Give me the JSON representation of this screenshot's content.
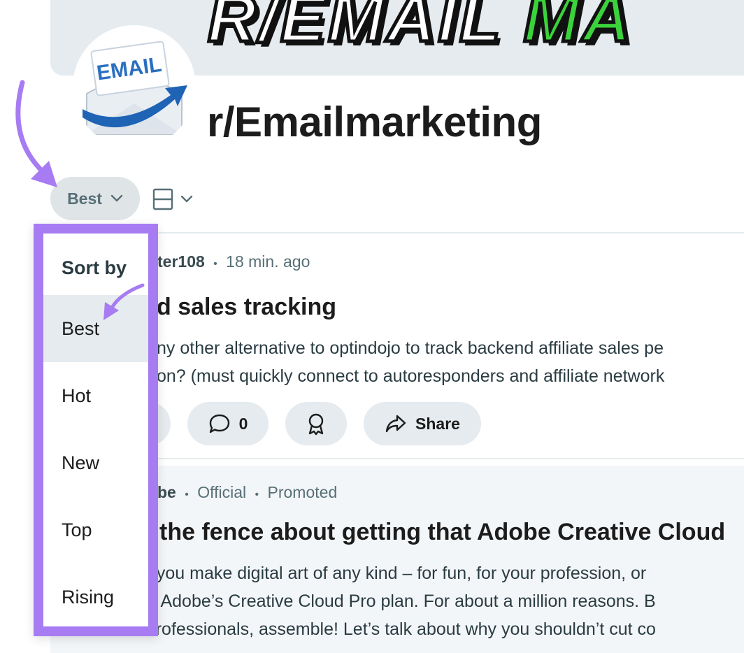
{
  "banner": {
    "text_main": "R/EMAIL ",
    "text_accent": "MA"
  },
  "avatar": {
    "label": "EMAIL"
  },
  "subreddit": {
    "title": "r/Emailmarketing"
  },
  "sort": {
    "current": "Best"
  },
  "view_toggle": {
    "icon": "card-layout-icon"
  },
  "dropdown": {
    "header": "Sort by",
    "items": [
      {
        "label": "Best",
        "active": true
      },
      {
        "label": "Hot",
        "active": false
      },
      {
        "label": "New",
        "active": false
      },
      {
        "label": "Top",
        "active": false
      },
      {
        "label": "Rising",
        "active": false
      }
    ]
  },
  "posts": [
    {
      "author": "ter108",
      "sep": "•",
      "time": "18 min. ago",
      "title": "d sales tracking",
      "body": [
        "ny other alternative to optindojo to track backend affiliate sales pe",
        "on? (must quickly connect to autoresponders and affiliate network"
      ],
      "comments": "0",
      "share_label": "Share"
    },
    {
      "author": "be",
      "official": "Official",
      "promoted": "Promoted",
      "sep": "•",
      "title": "the fence about getting that Adobe Creative Cloud",
      "body": [
        "f you make digital art of any kind – for fun, for your profession, or",
        "n Adobe’s Creative Cloud Pro plan. For about a million reasons. B",
        "Creative Professionals, assemble! Let’s talk about why you shouldn’t cut co"
      ]
    }
  ],
  "colors": {
    "accent": "#a77cf3",
    "pill_bg": "#e5ebee",
    "banner_bg": "#e5ebee",
    "banner_green": "#3bd33b"
  }
}
